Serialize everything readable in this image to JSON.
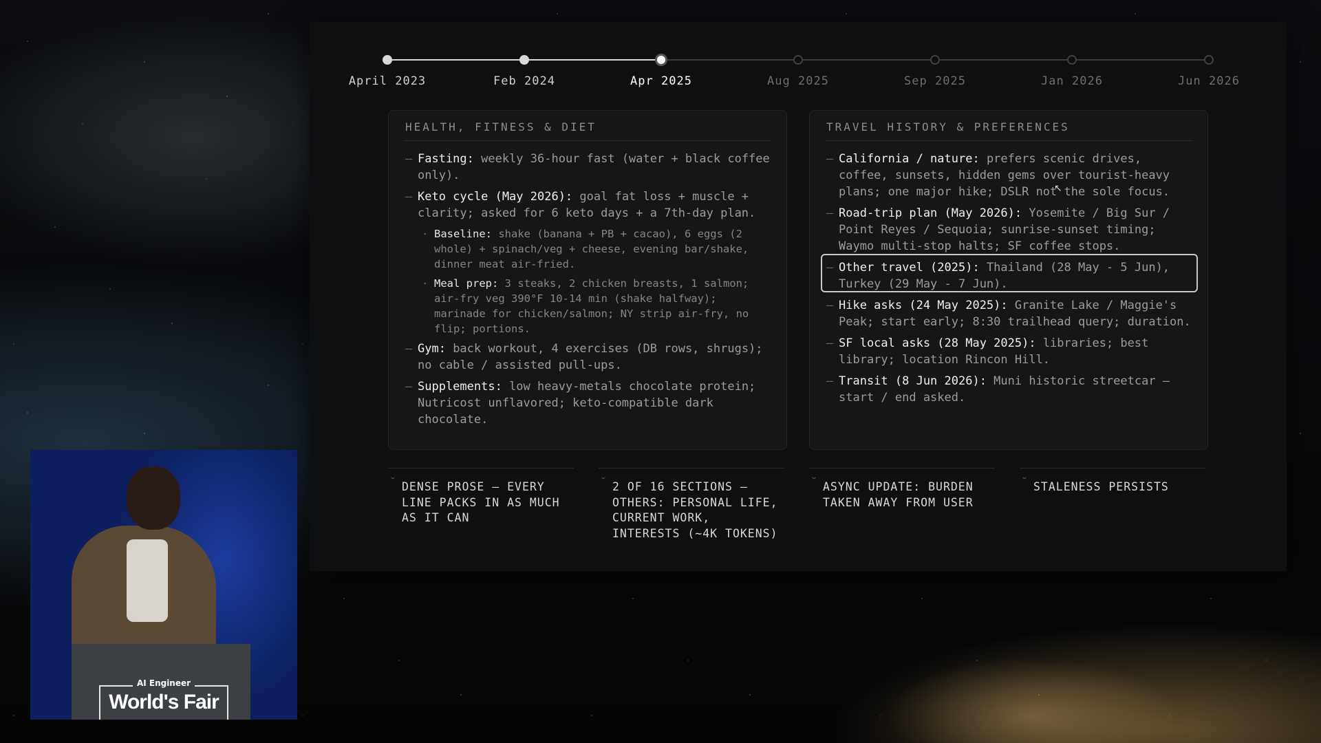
{
  "timeline": {
    "points": [
      {
        "label": "April 2023",
        "state": "past"
      },
      {
        "label": "Feb 2024",
        "state": "past"
      },
      {
        "label": "Apr 2025",
        "state": "current"
      },
      {
        "label": "Aug 2025",
        "state": "future"
      },
      {
        "label": "Sep 2025",
        "state": "future"
      },
      {
        "label": "Jan 2026",
        "state": "future"
      },
      {
        "label": "Jun 2026",
        "state": "future"
      }
    ]
  },
  "cards": {
    "health": {
      "title": "HEALTH, FITNESS & DIET",
      "items": [
        {
          "key": "Fasting:",
          "text": " weekly 36-hour fast (water + black coffee only)."
        },
        {
          "key": "Keto cycle (May 2026):",
          "text": " goal fat loss + muscle + clarity; asked for 6 keto days + a 7th-day plan.",
          "subs": [
            {
              "key": "Baseline:",
              "text": " shake (banana + PB + cacao), 6 eggs (2 whole) + spinach/veg + cheese, evening bar/shake, dinner meat air-fried."
            },
            {
              "key": "Meal prep:",
              "text": " 3 steaks, 2 chicken breasts, 1 salmon; air-fry veg 390°F 10-14 min (shake halfway); marinade for chicken/salmon; NY strip air-fry, no flip; portions."
            }
          ]
        },
        {
          "key": "Gym:",
          "text": " back workout, 4 exercises (DB rows, shrugs); no cable / assisted pull-ups."
        },
        {
          "key": "Supplements:",
          "text": " low heavy-metals chocolate protein; Nutricost unflavored; keto-compatible dark chocolate."
        }
      ]
    },
    "travel": {
      "title": "TRAVEL HISTORY & PREFERENCES",
      "items": [
        {
          "key": "California / nature:",
          "text": " prefers scenic drives, coffee, sunsets, hidden gems over tourist-heavy plans; one major hike; DSLR not the sole focus."
        },
        {
          "key": "Road-trip plan (May 2026):",
          "text": " Yosemite / Big Sur / Point Reyes / Sequoia; sunrise-sunset timing; Waymo multi-stop halts; SF coffee stops."
        },
        {
          "key": "Other travel (2025):",
          "text": " Thailand (28 May - 5 Jun), Turkey (29 May - 7 Jun)."
        },
        {
          "key": "Hike asks (24 May 2025):",
          "text": " Granite Lake / Maggie's Peak; start early; 8:30 trailhead query; duration."
        },
        {
          "key": "SF local asks (28 May 2025):",
          "text": " libraries; best library; location Rincon Hill."
        },
        {
          "key": "Transit (8 Jun 2026):",
          "text": " Muni historic streetcar — start / end asked."
        }
      ]
    }
  },
  "footnotes": [
    "DENSE PROSE — EVERY LINE PACKS IN AS MUCH AS IT CAN",
    "2 OF 16 SECTIONS — OTHERS: PERSONAL LIFE, CURRENT WORK, INTERESTS (~4K TOKENS)",
    "ASYNC UPDATE: BURDEN TAKEN AWAY FROM USER",
    "STALENESS PERSISTS"
  ],
  "podium": {
    "small": "AI Engineer",
    "big": "World's Fair"
  },
  "colors": {
    "slide_bg": "#0e0f10",
    "card_bg": "#151617",
    "timeline_active": "#d8d8d8",
    "timeline_inactive": "#3a3b3d",
    "highlight_border": "#c9c9c9"
  }
}
